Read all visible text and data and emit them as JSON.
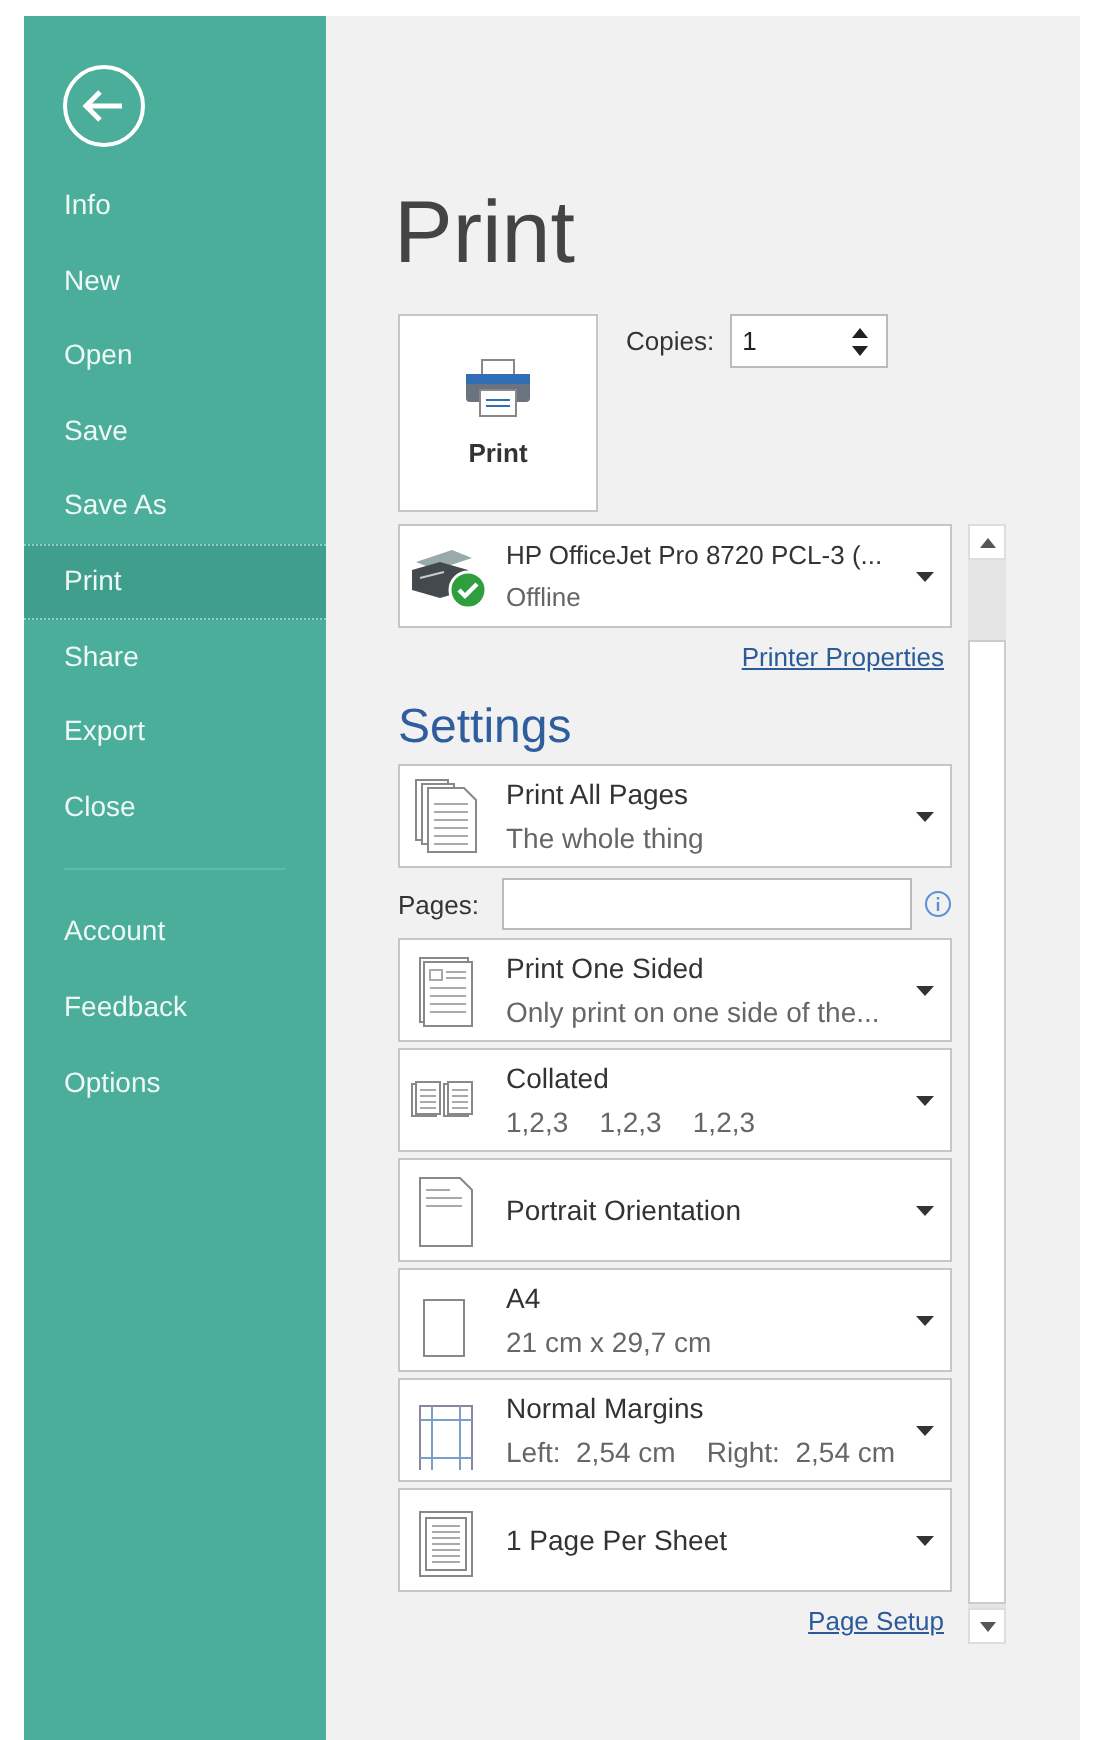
{
  "sidebar": {
    "items": [
      {
        "label": "Info",
        "selected": false
      },
      {
        "label": "New",
        "selected": false
      },
      {
        "label": "Open",
        "selected": false
      },
      {
        "label": "Save",
        "selected": false
      },
      {
        "label": "Save As",
        "selected": false
      },
      {
        "label": "Print",
        "selected": true
      },
      {
        "label": "Share",
        "selected": false
      },
      {
        "label": "Export",
        "selected": false
      },
      {
        "label": "Close",
        "selected": false
      }
    ],
    "bottom_items": [
      {
        "label": "Account",
        "selected": false
      },
      {
        "label": "Feedback",
        "selected": false
      },
      {
        "label": "Options",
        "selected": false
      }
    ]
  },
  "title": "Print",
  "print_button": {
    "label": "Print"
  },
  "copies": {
    "label": "Copies:",
    "value": "1"
  },
  "printer": {
    "name": "HP OfficeJet Pro 8720 PCL-3 (...",
    "status": "Offline",
    "ready": true
  },
  "printer_properties_link": "Printer Properties",
  "settings_heading": "Settings",
  "settings": [
    {
      "kind": "pages",
      "title": "Print All Pages",
      "subtitle": "The whole thing"
    },
    {
      "kind": "pages_field",
      "label": "Pages:"
    },
    {
      "kind": "sided",
      "title": "Print One Sided",
      "subtitle": "Only print on one side of the..."
    },
    {
      "kind": "collate",
      "title": "Collated",
      "subtitle": "1,2,3    1,2,3    1,2,3"
    },
    {
      "kind": "orientation",
      "title": "Portrait Orientation"
    },
    {
      "kind": "paper",
      "title": "A4",
      "subtitle": "21 cm x 29,7 cm"
    },
    {
      "kind": "margins",
      "title": "Normal Margins",
      "subtitle": "Left:  2,54 cm    Right:  2,54 cm"
    },
    {
      "kind": "persheet",
      "title": "1 Page Per Sheet"
    }
  ],
  "page_setup_link": "Page Setup"
}
